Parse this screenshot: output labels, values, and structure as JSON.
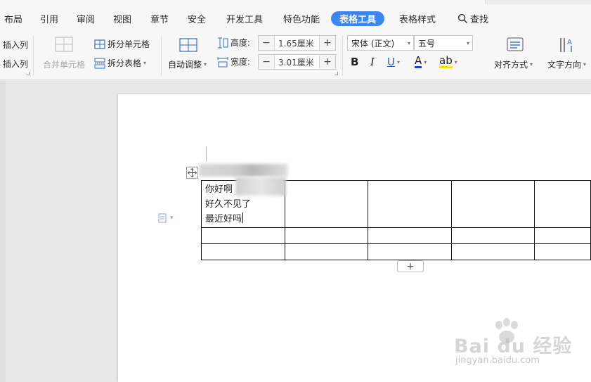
{
  "menu": {
    "items": [
      {
        "label": "布局",
        "active": false
      },
      {
        "label": "引用",
        "active": false
      },
      {
        "label": "审阅",
        "active": false
      },
      {
        "label": "视图",
        "active": false
      },
      {
        "label": "章节",
        "active": false
      },
      {
        "label": "安全",
        "active": false
      },
      {
        "label": "开发工具",
        "active": false
      },
      {
        "label": "特色功能",
        "active": false
      },
      {
        "label": "表格工具",
        "active": true
      },
      {
        "label": "表格样式",
        "active": false
      }
    ],
    "search_label": "查找",
    "active_color": "#3d86f0"
  },
  "ribbon": {
    "insert_col_1": "插入列",
    "insert_col_2": "插入列",
    "merge_cells": "合并单元格",
    "split_cells": "拆分单元格",
    "split_table": "拆分表格",
    "auto_fit": "自动调整",
    "height_label": "高度:",
    "height_value": "1.65厘米",
    "width_label": "宽度:",
    "width_value": "3.01厘米",
    "font_name": "宋体 (正文)",
    "font_size": "五号",
    "bold": "B",
    "italic": "I",
    "underline": "U",
    "font_color": "A",
    "highlight": "ab",
    "align": "对齐方式",
    "text_direction": "文字方向",
    "spin_minus": "−",
    "spin_plus": "+"
  },
  "document": {
    "cell_lines": [
      "你好啊",
      "好久不见了",
      "最近好吗"
    ],
    "add_row_label": "+"
  },
  "watermark": {
    "logo": "Bai  du 经验",
    "url": "jingyan.baidu.com"
  }
}
